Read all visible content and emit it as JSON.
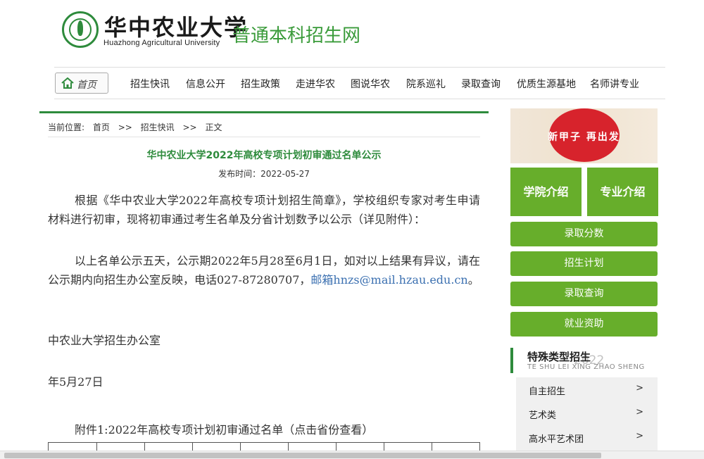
{
  "header": {
    "logo_cn": "华中农业大学",
    "logo_en": "Huazhong Agricultural University",
    "site_title": "普通本科招生网"
  },
  "nav": {
    "home": "首页",
    "items": [
      "招生快讯",
      "信息公开",
      "招生政策",
      "走进华农",
      "图说华农",
      "院系巡礼",
      "录取查询",
      "优质生源基地",
      "名师讲专业"
    ]
  },
  "breadcrumb": {
    "prefix": "当前位置:",
    "home": "首页",
    "sep": ">>",
    "section": "招生快讯",
    "current": "正文"
  },
  "article": {
    "title": "华中农业大学2022年高校专项计划初审通过名单公示",
    "date": "发布时间：2022-05-27",
    "para1": "根据《华中农业大学2022年高校专项计划招生简章》，学校组织专家对考生申请材料进行初审，现将初审通过考生名单及分省计划数予以公示（详见附件）：",
    "para2_text": "以上名单公示五天，公示期2022年5月28至6月1日，如对以上结果有异议，请在公示期内向招生办公室反映，电话027-87280707，",
    "para2_link": "邮箱hnzs@mail.hzau.edu.cn",
    "para2_end": "。",
    "signature": "中农业大学招生办公室",
    "sign_date": "年5月27日",
    "attachment": "附件1:2022年高校专项计划初审通过名单（点击省份查看）"
  },
  "sidebar": {
    "banner_text": "新甲子 再出发",
    "big_buttons": [
      "学院介绍",
      "专业介绍"
    ],
    "buttons": [
      "录取分数",
      "招生计划",
      "录取查询",
      "就业资助"
    ],
    "special": {
      "title": "特殊类型招生",
      "subtitle": "TE SHU LEI XING ZHAO SHENG",
      "year": "2022",
      "items": [
        "自主招生",
        "艺术类",
        "高水平艺术团"
      ],
      "arrow": ">"
    }
  },
  "colors": {
    "brand_green": "#2e8b3c",
    "button_green": "#67ae2b",
    "link_blue": "#3a6fb0"
  }
}
